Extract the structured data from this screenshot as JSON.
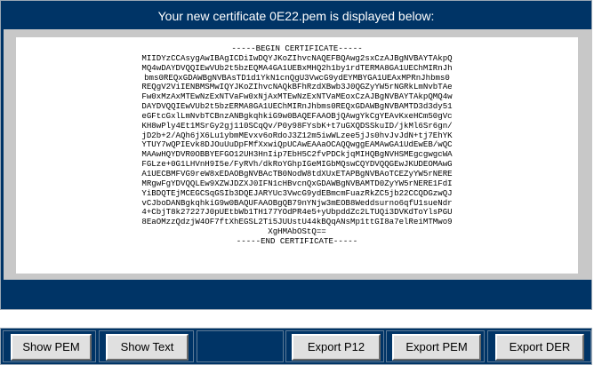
{
  "header": {
    "title": "Your new certificate 0E22.pem is displayed below:"
  },
  "certificate": {
    "lines": [
      "-----BEGIN CERTIFICATE-----",
      "MIIDYzCCAsygAwIBAgICDiIwDQYJKoZIhvcNAQEFBQAwg2sxCzAJBgNVBAYTAkpQ",
      "MQ4wDAYDVQQIEwVUb2t5bzEQMA4GA1UEBxMHQ2h1by1rdTERMA8GA1UEChMIRnJh",
      "bms0REQxGDAWBgNVBAsTD1d1YkN1cnQgU3VwcG9ydEYMBYGA1UEAxMPRnJhbms0",
      "REQgV2ViIENBMSMwIQYJKoZIhvcNAQkBFhRzdXBwb3J0QGZyYW5rNGRkLmNvbTAe",
      "Fw0xMzAxMTEwNzExNTVaFw0xNjAxMTEwNzExNTVaMEoxCzAJBgNVBAYTAkpQMQ4w",
      "DAYDVQQIEwVUb2t5bzERMA8GA1UEChMIRnJhbms0REQxGDAWBgNVBAMTD3d3dy51",
      "eGFtcGxlLmNvbTCBnzANBgkqhkiG9w0BAQEFAAOBjQAwgYkCgYEAvKxeHCm50gVc",
      "KH8wPly4Et1MSrGy2gj110SCqQv/P0y98FYsbK+t7uGXQDSSkuID/jkMl6Sr6gn/",
      "jD2b+2/AQh6jX6Lu1ybmMEvxv6oRdoJ3Z12m5iwWLzee5jJs0hvJvJdN+tj7EhYK",
      "YTUY7wQPIEvk8DJOuUuDpFMfXxwiQpUCAwEAAaOCAQQwggEAMAwGA1UdEwEB/wQC",
      "MAAwHQYDVR0OBBYEFGO12UH3HnIip7EbH5C2fvPDCkjqMIHQBgNVHSMEgcgwgcWA",
      "FGLze+0G1LHVnH9I5e/FyRVh/dkRoYGhpIGeMIGbMQswCQYDVQQGEwJKUDEOMAwG",
      "A1UECBMFVG9reW8xEDAOBgNVBAcTB0NodW8tdXUxETAPBgNVBAoTCEZyYW5rNERE",
      "MRgwFgYDVQQLEw9XZWJDZXJ0IFN1cHBvcnQxGDAWBgNVBAMTD0ZyYW5rNERE1FdI",
      "YiBDQTEjMCEGCSqGSIb3DQEJARYUc3VwcG9ydEBmcmFuazRkZC5jb22CCQDGzwQJ",
      "vCJboDANBgkqhkiG9w0BAQUFAAOBgQB79nYNjw3mEOB8Weddsurno6qfU1sueNdr",
      "4+CbjT8k27227J0pUEtbWb1TH177YOdPR4e5+yUbpddZc2LTUQi3DVKdToYlsPGU",
      "8EaOMzzQdzjW4OF7ftXhEGSL2Ti5JUUstU44kBQqANsMp1ttGI8a7elReiMTMwo9",
      "XgHMAbOStQ==",
      "-----END CERTIFICATE-----"
    ]
  },
  "buttons": {
    "show_pem": "Show PEM",
    "show_text": "Show Text",
    "export_p12": "Export P12",
    "export_pem": "Export PEM",
    "export_der": "Export DER"
  },
  "colors": {
    "panel_background": "#003466",
    "frame_background": "#c8c8c8",
    "button_face": "#e0e0e0"
  }
}
